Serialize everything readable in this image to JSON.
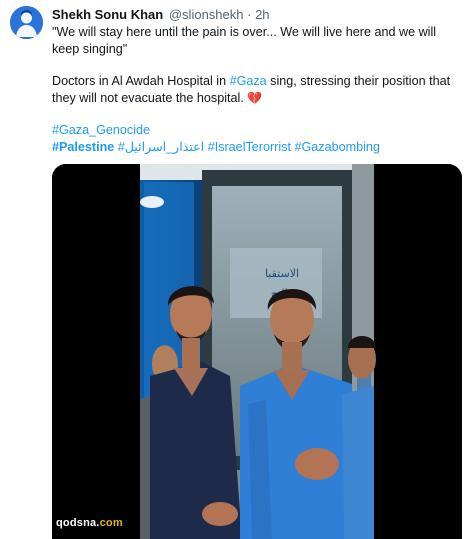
{
  "author": {
    "name": "Shekh Sonu Khan",
    "handle": "@slionshekh",
    "separator": "·",
    "time": "2h",
    "avatar_icon": "person-avatar-icon"
  },
  "tweet": {
    "quote": "\"We will stay here until the pain is over... We will live here and we will keep singing\"",
    "line2_before": "Doctors in Al Awdah Hospital in ",
    "line2_tag": "#Gaza",
    "line2_after": " sing, stressing their position that they will not evacuate the hospital. ",
    "heart": "💔",
    "hashtag_genocide": "#Gaza_Genocide",
    "hashtag_palestine": "#Palestine",
    "hashtag_arabic": "#اعتذار_اسرائيل",
    "hashtag_israel": "#IsraelTerorrist",
    "hashtag_gazabombing": "#Gazabombing"
  },
  "media": {
    "type": "video",
    "sign_arabic_1": "الاستقبا",
    "sign_arabic_2": "والتح"
  },
  "watermark": {
    "text_main": "qodsna.",
    "text_accent": "com"
  },
  "colors": {
    "link": "#1d9bf0",
    "scrub": "#2b6fb3",
    "doctor_scrub": "#2f7fd6",
    "dark_scrub": "#1e2a4a"
  }
}
